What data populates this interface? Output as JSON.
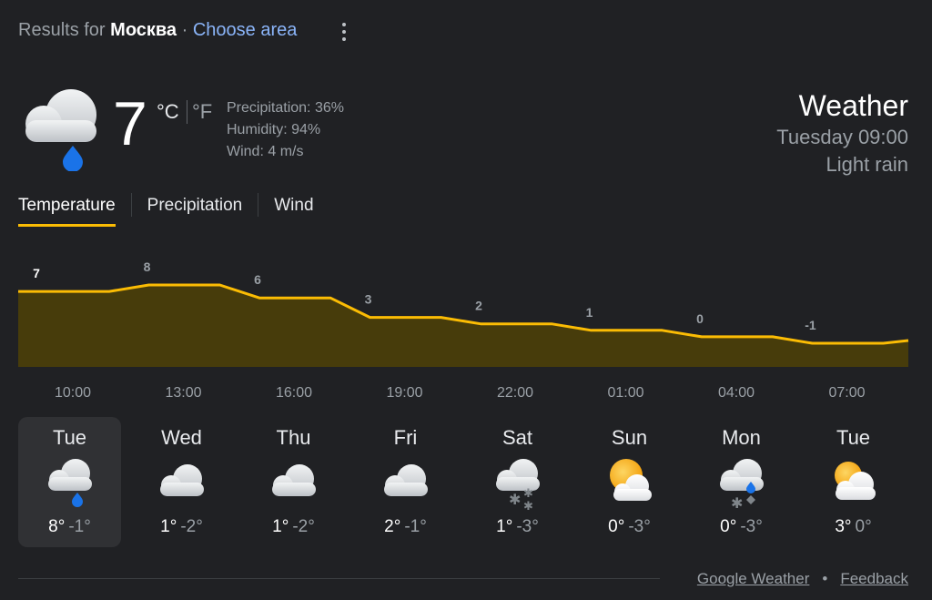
{
  "header": {
    "results_prefix": "Results for",
    "location": "Москва",
    "separator": "·",
    "choose_area": "Choose area"
  },
  "current": {
    "temperature": "7",
    "unit_c": "°C",
    "unit_f": "°F",
    "icon": "cloud-rain-icon",
    "precipitation": "Precipitation: 36%",
    "humidity": "Humidity: 94%",
    "wind": "Wind: 4 m/s"
  },
  "summary": {
    "title": "Weather",
    "datetime": "Tuesday 09:00",
    "condition": "Light rain"
  },
  "tabs": [
    {
      "label": "Temperature",
      "active": true
    },
    {
      "label": "Precipitation",
      "active": false
    },
    {
      "label": "Wind",
      "active": false
    }
  ],
  "chart_data": {
    "type": "area",
    "x": [
      "10:00",
      "13:00",
      "16:00",
      "19:00",
      "22:00",
      "01:00",
      "04:00",
      "07:00"
    ],
    "values": [
      7,
      8,
      6,
      3,
      2,
      1,
      0,
      -1
    ],
    "data_labels": [
      "7",
      "8",
      "6",
      "3",
      "2",
      "1",
      "0",
      "-1"
    ],
    "xlabel": "",
    "ylabel": "",
    "grid": false,
    "legend": "none",
    "line_color": "#fbbc04",
    "fill_color": "#473c0b"
  },
  "days": [
    {
      "name": "Tue",
      "icon": "cloud-rain-icon",
      "high": "8°",
      "low": "-1°",
      "selected": true
    },
    {
      "name": "Wed",
      "icon": "cloud-icon",
      "high": "1°",
      "low": "-2°",
      "selected": false
    },
    {
      "name": "Thu",
      "icon": "cloud-icon",
      "high": "1°",
      "low": "-2°",
      "selected": false
    },
    {
      "name": "Fri",
      "icon": "cloud-icon",
      "high": "2°",
      "low": "-1°",
      "selected": false
    },
    {
      "name": "Sat",
      "icon": "cloud-snow-icon",
      "high": "1°",
      "low": "-3°",
      "selected": false
    },
    {
      "name": "Sun",
      "icon": "partly-cloudy-icon",
      "high": "0°",
      "low": "-3°",
      "selected": false
    },
    {
      "name": "Mon",
      "icon": "cloud-sleet-icon",
      "high": "0°",
      "low": "-3°",
      "selected": false
    },
    {
      "name": "Tue",
      "icon": "partly-cloudy-icon",
      "high": "3°",
      "low": "0°",
      "selected": false
    }
  ],
  "footer": {
    "google_weather": "Google Weather",
    "dot": "•",
    "feedback": "Feedback"
  },
  "colors": {
    "background": "#202124",
    "accent": "#fbbc04",
    "link": "#8ab4f8",
    "rain": "#1a73e8"
  }
}
